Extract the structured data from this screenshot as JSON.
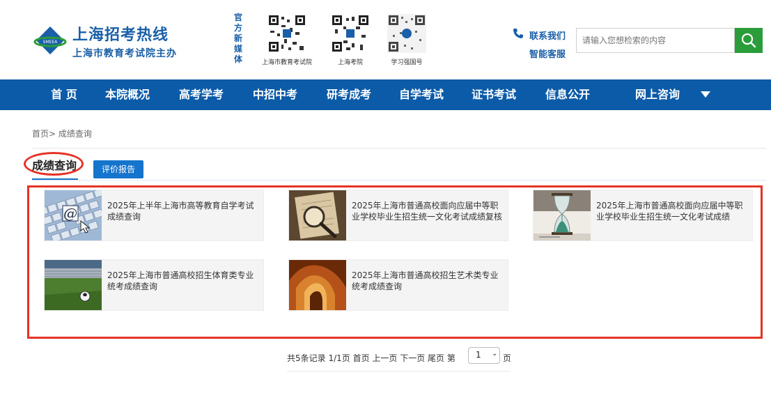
{
  "header": {
    "site_title": "上海招考热线",
    "site_subtitle": "上海市教育考试院主办",
    "media_label": "官方新媒体",
    "qr_codes": [
      {
        "caption": "上海市教育考试院"
      },
      {
        "caption": "上海考院"
      },
      {
        "caption": "学习强国号"
      }
    ],
    "contact_label": "联系我们",
    "service_label": "智能客服",
    "phone_icon": "phone-icon",
    "search_placeholder": "请输入您想检索的内容",
    "search_icon": "search-icon"
  },
  "nav": {
    "items": [
      "首 页",
      "本院概况",
      "高考学考",
      "中招中考",
      "研考成考",
      "自学考试",
      "证书考试",
      "信息公开",
      "网上咨询"
    ],
    "more_icon": "dropdown-arrow-icon"
  },
  "breadcrumb": "首页> 成绩查询",
  "tabs": {
    "active": "成绩查询",
    "other": "评价报告"
  },
  "results": [
    {
      "title": "2025年上半年上海市高等教育自学考试成绩查询",
      "thumb": "keyboard-at-image"
    },
    {
      "title": "2025年上海市普通高校面向应届中等职业学校毕业生招生统一文化考试成绩复核",
      "thumb": "magnifier-image"
    },
    {
      "title": "2025年上海市普通高校面向应届中等职业学校毕业生招生统一文化考试成绩",
      "thumb": "hourglass-image"
    },
    {
      "title": "2025年上海市普通高校招生体育类专业统考成绩查询",
      "thumb": "stadium-image"
    },
    {
      "title": "2025年上海市普通高校招生艺术类专业统考成绩查询",
      "thumb": "arches-image"
    }
  ],
  "pagination": {
    "summary": "共5条记录 1/1页 首页 上一页 下一页 尾页 第",
    "page": "1",
    "suffix": "页"
  },
  "colors": {
    "nav_bg": "#0c5ba8",
    "brand_blue": "#1a5fa8",
    "search_green": "#2a9d3a",
    "highlight_red": "#e53325"
  }
}
